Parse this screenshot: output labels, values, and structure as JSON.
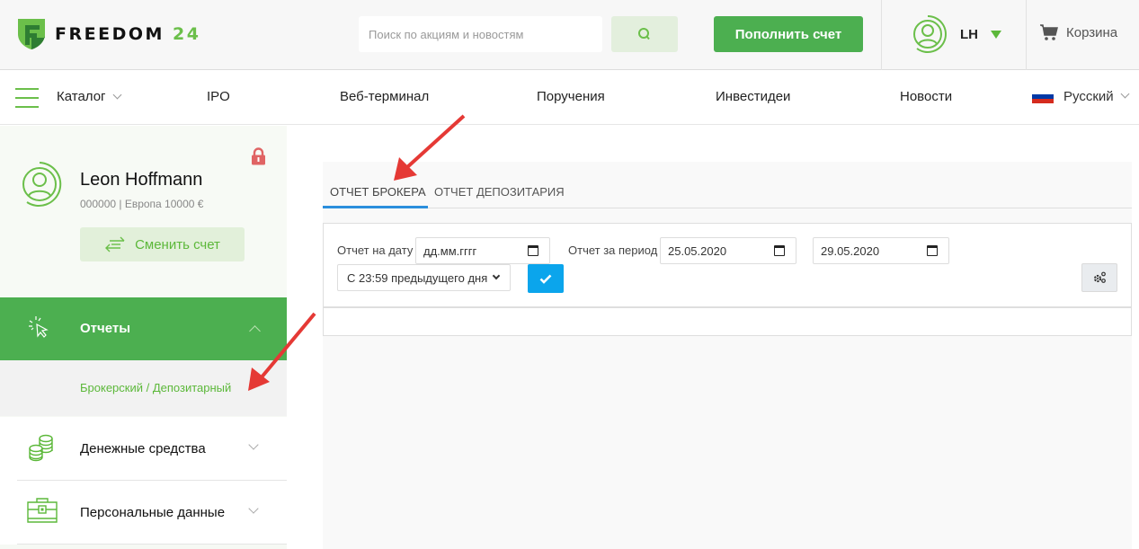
{
  "header": {
    "logo": {
      "word": "FREEDOM",
      "number": "24"
    },
    "search": {
      "placeholder": "Поиск по акциям и новостям",
      "value": ""
    },
    "topup_label": "Пополнить счет",
    "user_initials": "LH",
    "cart_label": "Корзина"
  },
  "nav": {
    "catalog": "Каталог",
    "items": [
      "IPO",
      "Веб-терминал",
      "Поручения",
      "Инвестидеи",
      "Новости"
    ],
    "language": "Русский"
  },
  "sidebar": {
    "user_name": "Leon Hoffmann",
    "account_info": "000000 | Европа 10000 €",
    "switch_account_label": "Сменить счет",
    "menu": [
      {
        "label": "Отчеты",
        "icon": "cursor-click-icon",
        "expanded": true,
        "children": [
          "Брокерский / Депозитарный"
        ]
      },
      {
        "label": "Денежные средства",
        "icon": "coins-icon",
        "expanded": false
      },
      {
        "label": "Персональные данные",
        "icon": "briefcase-icon",
        "expanded": false
      }
    ]
  },
  "report": {
    "tabs": [
      {
        "label": "ОТЧЕТ БРОКЕРА",
        "active": true
      },
      {
        "label": "ОТЧЕТ ДЕПОЗИТАРИЯ",
        "active": false
      }
    ],
    "date_label": "Отчет на дату",
    "date_placeholder": "дд.мм.гггг",
    "period_label": "Отчет за период",
    "period_from": "25.05.2020",
    "period_to": "29.05.2020",
    "time_option": "С 23:59 предыдущего дня"
  },
  "colors": {
    "brand_green": "#4caf50",
    "accent_blue": "#0ba5ec",
    "tab_underline": "#2b8fdd",
    "annotation_red": "#e53935",
    "lock_red": "#e06464"
  }
}
